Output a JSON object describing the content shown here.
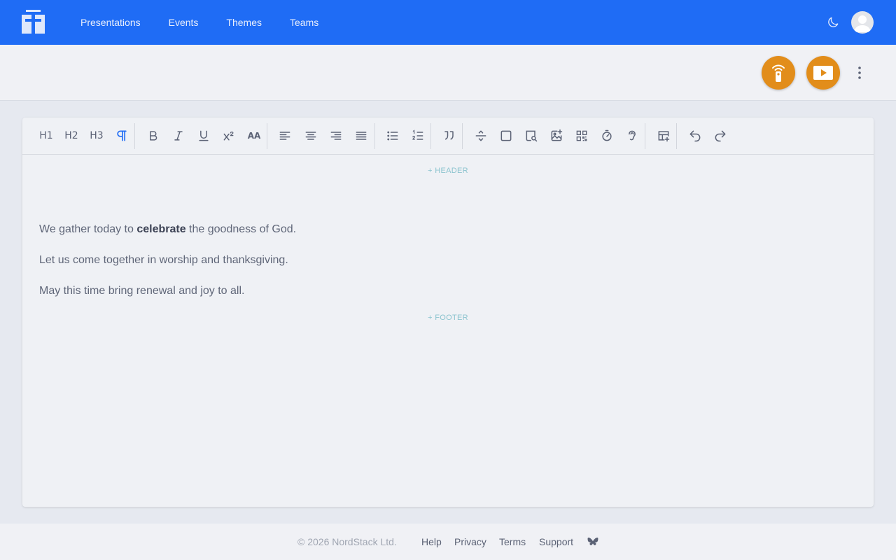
{
  "nav": {
    "items": [
      {
        "label": "Presentations"
      },
      {
        "label": "Events"
      },
      {
        "label": "Themes"
      },
      {
        "label": "Teams"
      }
    ]
  },
  "toolbar": {
    "h1": "H1",
    "h2": "H2",
    "h3": "H3",
    "active_tool": "paragraph",
    "font_size_label": "AA"
  },
  "editor": {
    "header_link": "+ HEADER",
    "footer_link": "+ FOOTER",
    "para1_before": "We gather today to ",
    "para1_bold": "celebrate",
    "para1_after": " the goodness of God.",
    "para2": "Let us come together in worship and thanksgiving.",
    "para3": "May this time bring renewal and joy to all."
  },
  "footer": {
    "copyright": "© 2026 NordStack Ltd.",
    "links": [
      {
        "label": "Help"
      },
      {
        "label": "Privacy"
      },
      {
        "label": "Terms"
      },
      {
        "label": "Support"
      }
    ]
  },
  "colors": {
    "nav_bg": "#1f6cf5",
    "accent_orange": "#e28d1a",
    "active_tool": "#1f6cf5"
  }
}
